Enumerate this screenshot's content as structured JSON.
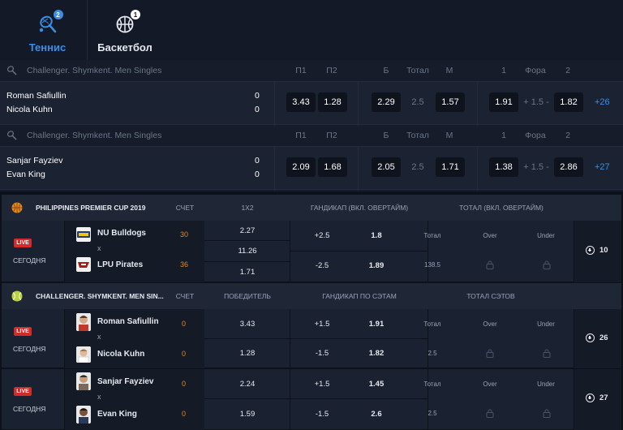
{
  "sports_tabs": [
    {
      "label": "Теннис",
      "count": "2",
      "icon": "tennis-icon",
      "active": true
    },
    {
      "label": "Баскетбол",
      "count": "1",
      "icon": "basketball-icon",
      "active": false
    }
  ],
  "accent_color": "#3a8ee8",
  "top_leagues": [
    {
      "name": "Challenger. Shymkent. Men Singles",
      "headers": [
        "П1",
        "П2",
        "Б",
        "Тотал",
        "М",
        "1",
        "Фора",
        "2"
      ],
      "match": {
        "player1": "Roman Safiullin",
        "player2": "Nicola Kuhn",
        "score1": "0",
        "score2": "0",
        "p1": "3.43",
        "p2": "1.28",
        "over": "2.29",
        "total": "2.5",
        "under": "1.57",
        "h1": "1.91",
        "handicap": "+ 1.5 -",
        "h2": "1.82",
        "more": "+26"
      }
    },
    {
      "name": "Challenger. Shymkent. Men Singles",
      "headers": [
        "П1",
        "П2",
        "Б",
        "Тотал",
        "М",
        "1",
        "Фора",
        "2"
      ],
      "match": {
        "player1": "Sanjar Fayziev",
        "player2": "Evan King",
        "score1": "0",
        "score2": "0",
        "p1": "2.09",
        "p2": "1.68",
        "over": "2.05",
        "total": "2.5",
        "under": "1.71",
        "h1": "1.38",
        "handicap": "+ 1.5 -",
        "h2": "2.86",
        "more": "+27"
      }
    }
  ],
  "bottom": {
    "basket_league": {
      "name": "PHILIPPINES PREMIER CUP 2019",
      "col_score": "СЧЕТ",
      "col_main": "1X2",
      "col_handicap": "ГАНДИКАП (ВКЛ. ОВЕРТАЙМ)",
      "col_total": "ТОТАЛ (ВКЛ. ОВЕРТАЙМ)",
      "event": {
        "live": "LIVE",
        "when": "СЕГОДНЯ",
        "team1": "NU Bulldogs",
        "team2": "LPU Pirates",
        "x": "x",
        "score1": "30",
        "score2": "36",
        "odds_1x2": [
          "2.27",
          "11.26",
          "1.71"
        ],
        "hcap1_line": "+2.5",
        "hcap1_odd": "1.8",
        "hcap2_line": "-2.5",
        "hcap2_odd": "1.89",
        "total_label": "Тотал",
        "total_value": "138.5",
        "over_label": "Over",
        "under_label": "Under",
        "markets": "10"
      }
    },
    "tennis_league": {
      "name": "CHALLENGER. SHYMKENT. MEN SIN...",
      "col_score": "СЧЕТ",
      "col_main": "ПОБЕДИТЕЛЬ",
      "col_handicap": "ГАНДИКАП ПО СЭТАМ",
      "col_total": "ТОТАЛ СЭТОВ",
      "events": [
        {
          "live": "LIVE",
          "when": "СЕГОДНЯ",
          "team1": "Roman Safiullin",
          "team2": "Nicola Kuhn",
          "x": "x",
          "score1": "0",
          "score2": "0",
          "win1": "3.43",
          "win2": "1.28",
          "hcap1_line": "+1.5",
          "hcap1_odd": "1.91",
          "hcap2_line": "-1.5",
          "hcap2_odd": "1.82",
          "total_label": "Тотал",
          "total_value": "2.5",
          "over_label": "Over",
          "under_label": "Under",
          "markets": "26"
        },
        {
          "live": "LIVE",
          "when": "СЕГОДНЯ",
          "team1": "Sanjar Fayziev",
          "team2": "Evan King",
          "x": "x",
          "score1": "0",
          "score2": "0",
          "win1": "2.24",
          "win2": "1.59",
          "hcap1_line": "+1.5",
          "hcap1_odd": "1.45",
          "hcap2_line": "-1.5",
          "hcap2_odd": "2.6",
          "total_label": "Тотал",
          "total_value": "2.5",
          "over_label": "Over",
          "under_label": "Under",
          "markets": "27"
        }
      ]
    }
  }
}
